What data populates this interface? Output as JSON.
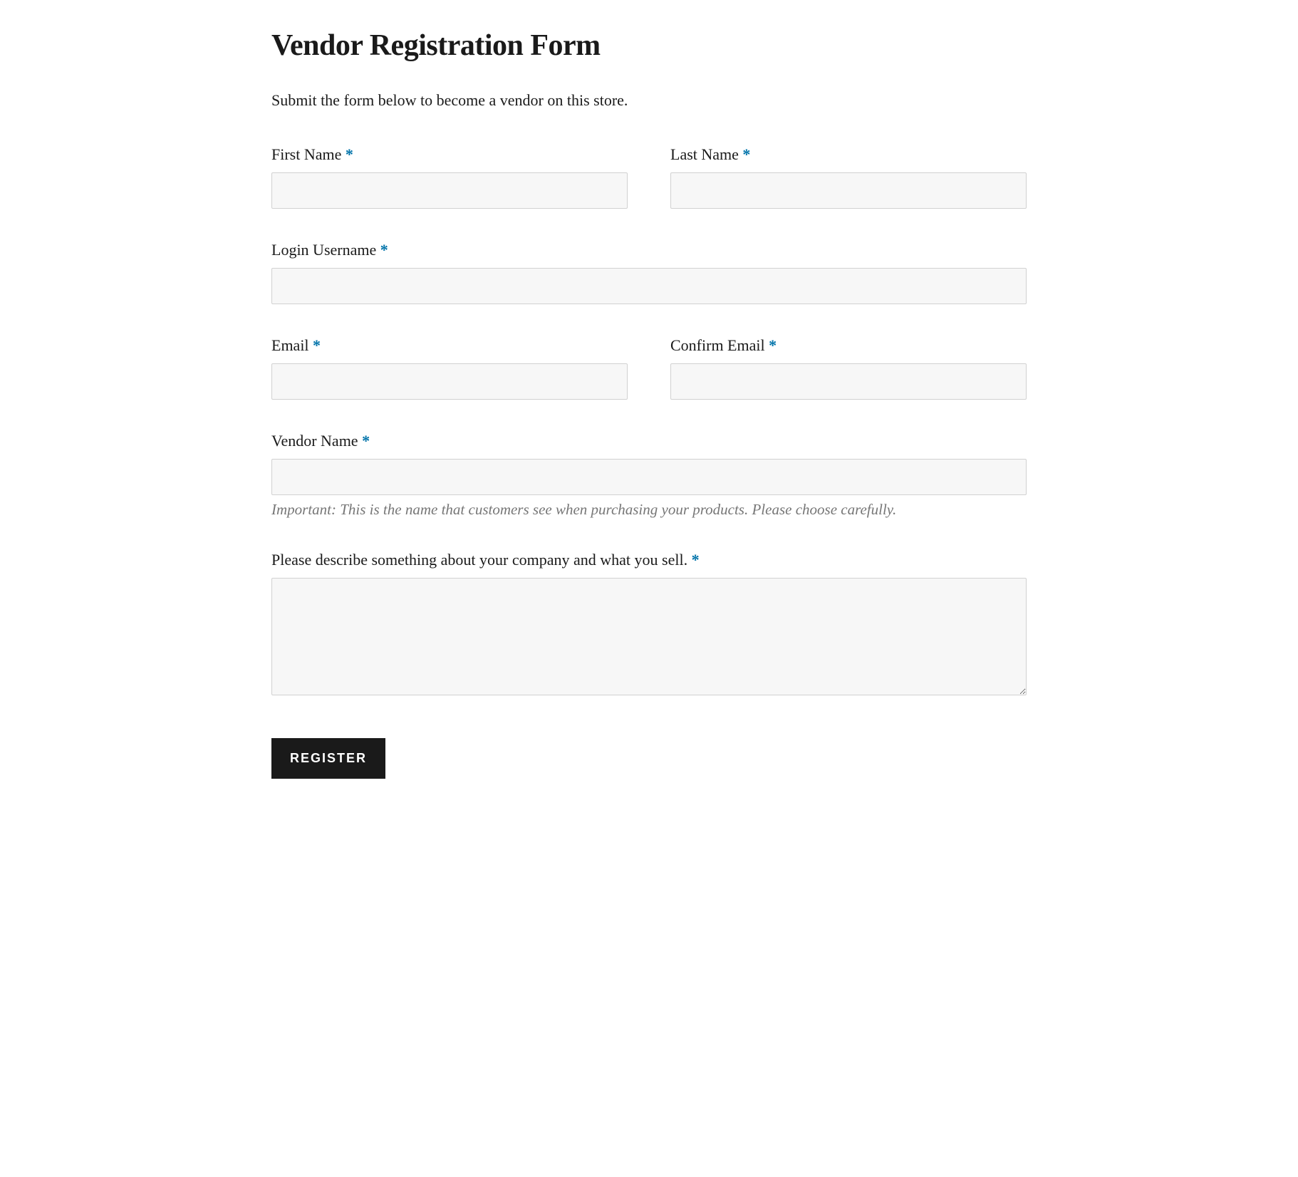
{
  "page": {
    "title": "Vendor Registration Form",
    "intro": "Submit the form below to become a vendor on this store."
  },
  "form": {
    "fields": {
      "first_name": {
        "label": "First Name",
        "required_mark": "*",
        "value": ""
      },
      "last_name": {
        "label": "Last Name",
        "required_mark": "*",
        "value": ""
      },
      "username": {
        "label": "Login Username",
        "required_mark": "*",
        "value": ""
      },
      "email": {
        "label": "Email",
        "required_mark": "*",
        "value": ""
      },
      "confirm_email": {
        "label": "Confirm Email",
        "required_mark": "*",
        "value": ""
      },
      "vendor_name": {
        "label": "Vendor Name",
        "required_mark": "*",
        "value": "",
        "help": "Important: This is the name that customers see when purchasing your products. Please choose carefully."
      },
      "description": {
        "label": "Please describe something about your company and what you sell.",
        "required_mark": "*",
        "value": ""
      }
    },
    "submit_label": "REGISTER"
  }
}
